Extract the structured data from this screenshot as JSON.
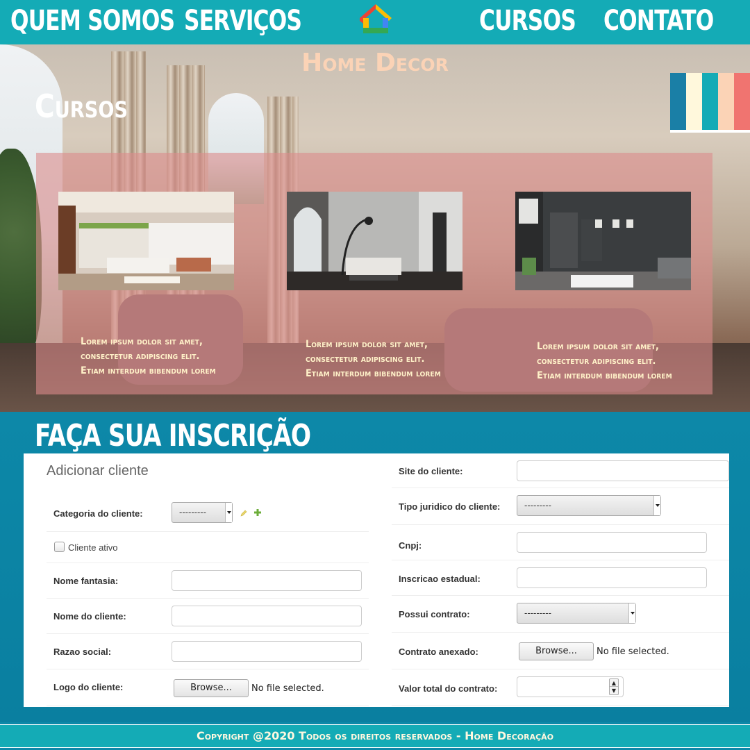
{
  "nav": {
    "items": [
      "QUEM SOMOS",
      "SERVIÇOS",
      "CURSOS",
      "CONTATO"
    ],
    "logo_icon": "home-logo-icon",
    "colors": {
      "bar": "#14abb6",
      "text": "#ffffff"
    }
  },
  "hero": {
    "brand": "Home Decor",
    "section_title": "Cursos",
    "palette_colors": [
      "#1a7fa6",
      "#fff8dc",
      "#14abb6",
      "#fbd3b6",
      "#f07470"
    ],
    "courses": [
      {
        "line1": "Lorem ipsum dolor sit amet,",
        "line2": "consectetur adipiscing elit.",
        "line3": "Etiam interdum bibendum lorem"
      },
      {
        "line1": "Lorem ipsum dolor sit amet,",
        "line2": "consectetur adipiscing elit.",
        "line3": "Etiam interdum bibendum lorem"
      },
      {
        "line1": "Lorem ipsum dolor sit amet,",
        "line2": "consectetur adipiscing elit.",
        "line3": "Etiam interdum bibendum lorem"
      }
    ]
  },
  "form": {
    "title": "FAÇA SUA INSCRIÇÃO",
    "heading": "Adicionar cliente",
    "left": {
      "categoria_label": "Categoria do cliente:",
      "categoria_value": "---------",
      "ativo_label": "Cliente ativo",
      "nome_fantasia_label": "Nome fantasia:",
      "nome_cliente_label": "Nome do cliente:",
      "razao_social_label": "Razao social:",
      "logo_label": "Logo do cliente:",
      "browse_label": "Browse...",
      "no_file": "No file selected."
    },
    "right": {
      "site_label": "Site do cliente:",
      "tipo_label": "Tipo juridico do cliente:",
      "tipo_value": "---------",
      "cnpj_label": "Cnpj:",
      "inscricao_label": "Inscricao estadual:",
      "contrato_label": "Possui contrato:",
      "contrato_value": "---------",
      "anexado_label": "Contrato anexado:",
      "browse_label": "Browse...",
      "no_file": "No file selected.",
      "valor_label": "Valor total do contrato:"
    }
  },
  "footer": {
    "text": "Copyright @2020 Todos os direitos reservados - Home Decoração"
  }
}
